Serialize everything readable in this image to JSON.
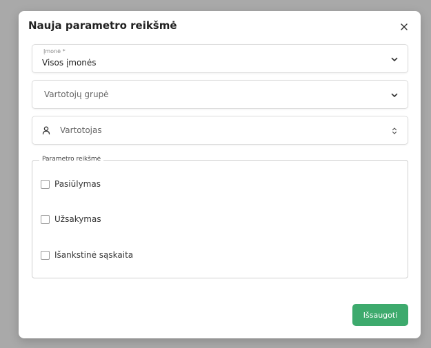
{
  "dialog": {
    "title": "Nauja parametro reikšmė",
    "close_icon": "close-icon"
  },
  "company_field": {
    "label": "Įmonė *",
    "value": "Visos įmonės",
    "icon": "chevron-down-icon"
  },
  "user_group_field": {
    "placeholder": "Vartotojų grupė",
    "icon": "chevron-down-icon"
  },
  "user_field": {
    "placeholder": "Vartotojas",
    "leading_icon": "user-icon",
    "trailing_icon": "chevron-up-down-icon"
  },
  "parameter_value": {
    "legend": "Parametro reikšmė",
    "options": [
      {
        "label": "Pasiūlymas",
        "checked": false
      },
      {
        "label": "Užsakymas",
        "checked": false
      },
      {
        "label": "Išankstinė sąskaita",
        "checked": false
      }
    ]
  },
  "actions": {
    "save_label": "Išsaugoti"
  },
  "colors": {
    "overlay": "#a9a9a9",
    "primary_button": "#3daa6d"
  }
}
